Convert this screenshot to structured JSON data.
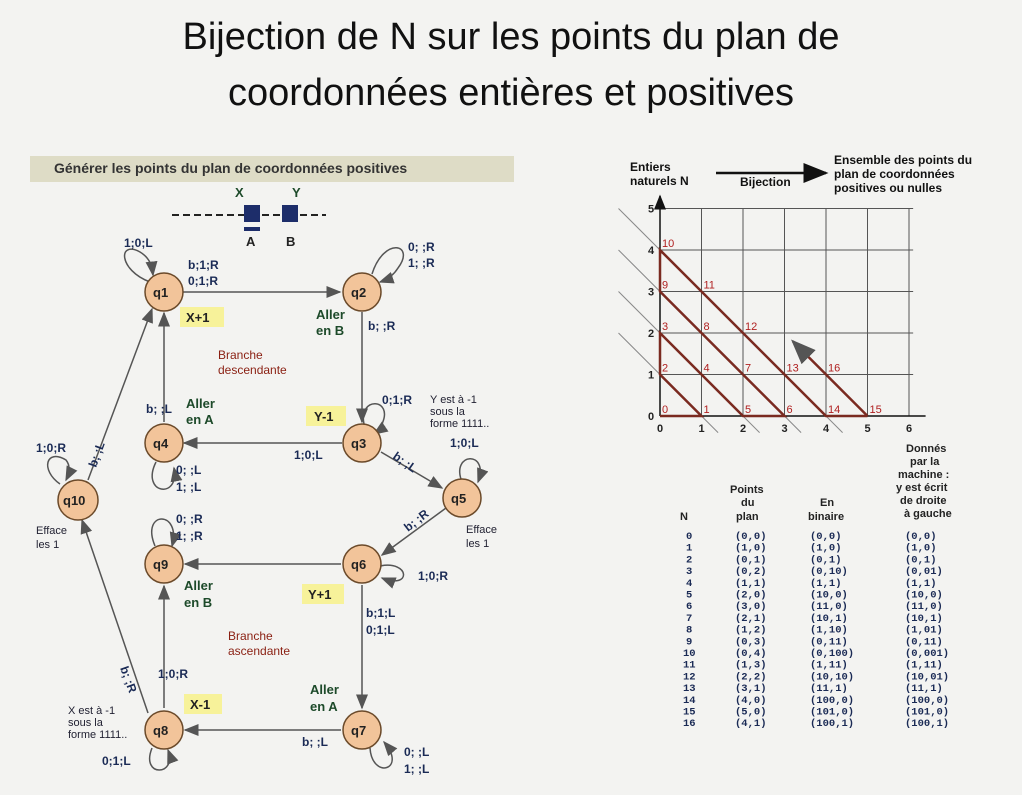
{
  "title_line1": "Bijection de N sur les points du plan de",
  "title_line2": "coordonnées entières et positives",
  "machine": {
    "banner": "Générer les points du plan de coordonnées positives",
    "tape": {
      "x": "X",
      "y": "Y",
      "a": "A",
      "b": "B"
    },
    "states": [
      "q1",
      "q2",
      "q3",
      "q4",
      "q5",
      "q6",
      "q7",
      "q8",
      "q9",
      "q10"
    ],
    "transitions": {
      "q1_loop": "1;0;L",
      "q1_q2_a": "b;1;R",
      "q1_q2_b": "0;1;R",
      "q2_loop_a": "0; ;R",
      "q2_loop_b": "1; ;R",
      "q2_q3": "b; ;R",
      "q3_loop": "0;1;R",
      "q3_q4": "1;0;L",
      "q4_q1": "b; ;L",
      "q4_loop_a": "0; ;L",
      "q4_loop_b": "1; ;L",
      "q3_q5": "b; ;L",
      "q5_loop": "1;0;L",
      "q5_q6": "b; ;R",
      "q6_loop": "1;0;R",
      "q6_q7_a": "b;1;L",
      "q6_q7_b": "0;1;L",
      "q9_loop_a": "0; ;R",
      "q9_loop_b": "1; ;R",
      "q7_q8": "b; ;L",
      "q7_loop_a": "0; ;L",
      "q7_loop_b": "1; ;L",
      "q8_q9": "1;0;R",
      "q8_loop": "0;1;L",
      "q8_q10": "b; ;R",
      "q10_loop": "1;0;R",
      "q10_q1": "b; ;L"
    },
    "labels": {
      "x_plus": "X+1",
      "y_minus": "Y-1",
      "y_plus": "Y+1",
      "x_minus": "X-1",
      "aller_b_1": "Aller",
      "aller_b_2": "en B",
      "aller_a_1": "Aller",
      "aller_a_2": "en A",
      "aller_b2_1": "Aller",
      "aller_b2_2": "en B",
      "aller_a2_1": "Aller",
      "aller_a2_2": "en A",
      "branche_desc_1": "Branche",
      "branche_desc_2": "descendante",
      "branche_asc_1": "Branche",
      "branche_asc_2": "ascendante",
      "efface_10_1": "Efface",
      "efface_10_2": "les 1",
      "efface_5_1": "Efface",
      "efface_5_2": "les 1",
      "y_note_1": "Y est à -1",
      "y_note_2": "sous la",
      "y_note_3": "forme 1111..",
      "x_note_1": "X est à -1",
      "x_note_2": "sous la",
      "x_note_3": "forme 1111.."
    }
  },
  "grid": {
    "header_left_1": "Entiers",
    "header_left_2": "naturels N",
    "header_mid": "Bijection",
    "header_right_1": "Ensemble des points du",
    "header_right_2": "plan de coordonnées",
    "header_right_3": "positives ou nulles",
    "x_ticks": [
      "0",
      "1",
      "2",
      "3",
      "4",
      "5",
      "6"
    ],
    "y_ticks": [
      "0",
      "1",
      "2",
      "3",
      "4",
      "5"
    ],
    "point_labels": [
      {
        "n": "0",
        "x": 0,
        "y": 0
      },
      {
        "n": "1",
        "x": 1,
        "y": 0
      },
      {
        "n": "2",
        "x": 0,
        "y": 1
      },
      {
        "n": "3",
        "x": 0,
        "y": 2
      },
      {
        "n": "4",
        "x": 1,
        "y": 1
      },
      {
        "n": "5",
        "x": 2,
        "y": 0
      },
      {
        "n": "6",
        "x": 3,
        "y": 0
      },
      {
        "n": "7",
        "x": 2,
        "y": 1
      },
      {
        "n": "8",
        "x": 1,
        "y": 2
      },
      {
        "n": "9",
        "x": 0,
        "y": 3
      },
      {
        "n": "10",
        "x": 0,
        "y": 4
      },
      {
        "n": "11",
        "x": 1,
        "y": 3
      },
      {
        "n": "12",
        "x": 2,
        "y": 2
      },
      {
        "n": "13",
        "x": 3,
        "y": 1
      },
      {
        "n": "14",
        "x": 4,
        "y": 0
      },
      {
        "n": "15",
        "x": 5,
        "y": 0
      },
      {
        "n": "16",
        "x": 4,
        "y": 1
      }
    ]
  },
  "table": {
    "headers": {
      "n": "N",
      "points_1": "Points",
      "points_2": "du",
      "points_3": "plan",
      "bin_1": "En",
      "bin_2": "binaire",
      "mach_1": "Donnés",
      "mach_2": "par la",
      "mach_3": "machine :",
      "mach_4": "y est écrit",
      "mach_5": "de droite",
      "mach_6": "à gauche"
    },
    "rows": [
      [
        "0",
        "(0,0)",
        "(0,0)",
        "(0,0)"
      ],
      [
        "1",
        "(1,0)",
        "(1,0)",
        "(1,0)"
      ],
      [
        "2",
        "(0,1)",
        "(0,1)",
        "(0,1)"
      ],
      [
        "3",
        "(0,2)",
        "(0,10)",
        "(0,01)"
      ],
      [
        "4",
        "(1,1)",
        "(1,1)",
        "(1,1)"
      ],
      [
        "5",
        "(2,0)",
        "(10,0)",
        "(10,0)"
      ],
      [
        "6",
        "(3,0)",
        "(11,0)",
        "(11,0)"
      ],
      [
        "7",
        "(2,1)",
        "(10,1)",
        "(10,1)"
      ],
      [
        "8",
        "(1,2)",
        "(1,10)",
        "(1,01)"
      ],
      [
        "9",
        "(0,3)",
        "(0,11)",
        "(0,11)"
      ],
      [
        "10",
        "(0,4)",
        "(0,100)",
        "(0,001)"
      ],
      [
        "11",
        "(1,3)",
        "(1,11)",
        "(1,11)"
      ],
      [
        "12",
        "(2,2)",
        "(10,10)",
        "(10,01)"
      ],
      [
        "13",
        "(3,1)",
        "(11,1)",
        "(11,1)"
      ],
      [
        "14",
        "(4,0)",
        "(100,0)",
        "(100,0)"
      ],
      [
        "15",
        "(5,0)",
        "(101,0)",
        "(101,0)"
      ],
      [
        "16",
        "(4,1)",
        "(100,1)",
        "(100,1)"
      ]
    ]
  },
  "colors": {
    "state_fill": "#f2c49a",
    "state_stroke": "#6b4a2a",
    "label_bg": "#f7f29a",
    "path": "#7a2a20",
    "grid_line": "#555555"
  }
}
